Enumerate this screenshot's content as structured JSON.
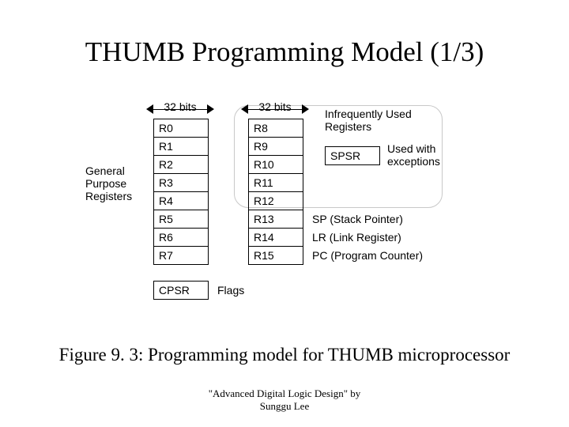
{
  "title": "THUMB Programming Model (1/3)",
  "widthLabel": "32 bits",
  "labels": {
    "gpr": "General\nPurpose\nRegisters",
    "infreq": "Infrequently Used\nRegisters",
    "spsr_note": "Used with\nexceptions",
    "flags": "Flags"
  },
  "col1": [
    "R0",
    "R1",
    "R2",
    "R3",
    "R4",
    "R5",
    "R6",
    "R7"
  ],
  "col2": [
    "R8",
    "R9",
    "R10",
    "R11",
    "R12",
    "R13",
    "R14",
    "R15"
  ],
  "col2_notes": {
    "R13": "SP (Stack Pointer)",
    "R14": "LR (Link Register)",
    "R15": "PC (Program Counter)"
  },
  "cpsr": "CPSR",
  "spsr": "SPSR",
  "caption": "Figure 9. 3: Programming model for THUMB microprocessor",
  "footer_line1": "\"Advanced Digital Logic Design\" by",
  "footer_line2": "Sunggu Lee"
}
